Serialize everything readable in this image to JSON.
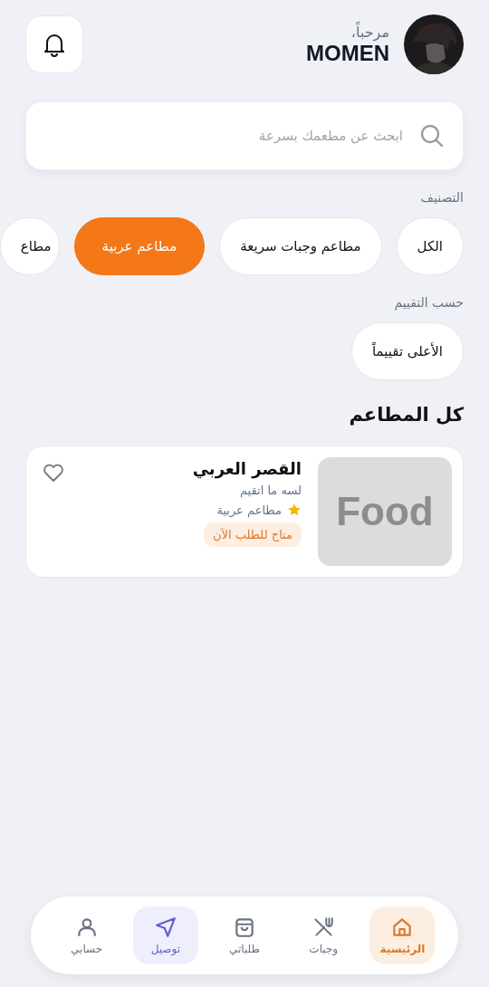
{
  "header": {
    "greeting": "مرحباً،",
    "user_name": "MOMEN"
  },
  "search": {
    "placeholder": "ابحث عن مطعمك بسرعة"
  },
  "categories": {
    "title": "التصنيف",
    "chips": [
      {
        "label": "الكل",
        "selected": false
      },
      {
        "label": "مطاعم وجبات سريعة",
        "selected": false
      },
      {
        "label": "مطاعم عربية",
        "selected": true
      },
      {
        "label": "مطاع",
        "selected": false
      }
    ]
  },
  "rating_filter": {
    "title": "حسب التقييم",
    "chips": [
      {
        "label": "الأعلى تقييماً",
        "selected": false
      }
    ]
  },
  "restaurants": {
    "title": "كل المطاعم",
    "items": [
      {
        "name": "القصر العربي",
        "image_text": "Food",
        "rating_text": "لسه ما اتقيم",
        "category": "مطاعم عربية",
        "status": "متاح للطلب الآن",
        "favorite": false
      }
    ]
  },
  "bottom_nav": [
    {
      "label": "الرئيسية",
      "kind": "home",
      "selected": true,
      "highlighted": false
    },
    {
      "label": "وجبات",
      "kind": "meals",
      "selected": false,
      "highlighted": false
    },
    {
      "label": "طلباتي",
      "kind": "orders",
      "selected": false,
      "highlighted": false
    },
    {
      "label": "توصيل",
      "kind": "delivery",
      "selected": false,
      "highlighted": true
    },
    {
      "label": "حسابي",
      "kind": "account",
      "selected": false,
      "highlighted": false
    }
  ]
}
